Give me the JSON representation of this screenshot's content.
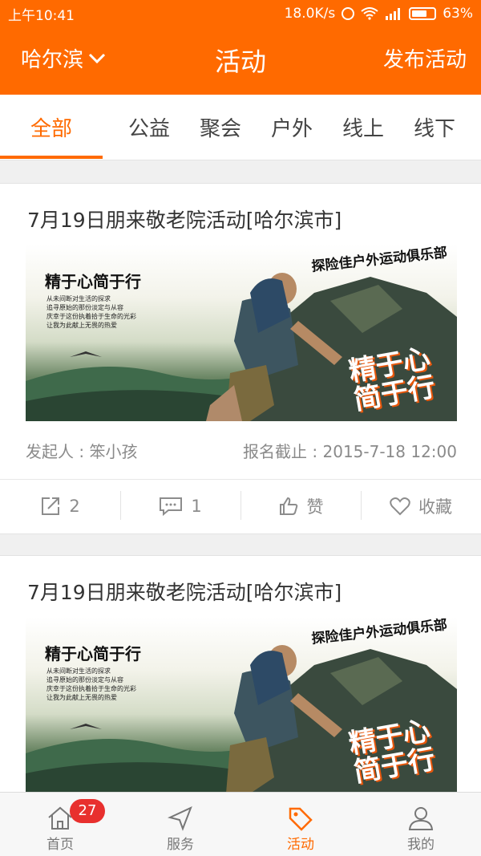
{
  "status_bar": {
    "time": "上午10:41",
    "network_speed": "18.0K/s",
    "battery_percent": "63%"
  },
  "header": {
    "city": "哈尔滨",
    "title": "活动",
    "publish_label": "发布活动",
    "background_color": "#ff6a00"
  },
  "tabs": [
    {
      "label": "全部",
      "active": true
    },
    {
      "label": "公益",
      "active": false
    },
    {
      "label": "聚会",
      "active": false
    },
    {
      "label": "户外",
      "active": false
    },
    {
      "label": "线上",
      "active": false
    },
    {
      "label": "线下",
      "active": false
    }
  ],
  "poster": {
    "headline": "精于心简于行",
    "lines": [
      "从未间断对生活的探求",
      "追寻原始的那份淡定与从容",
      "庆幸于这份执着拾于生命的光彩",
      "让我为此献上无畏的热爱"
    ],
    "club": "探险佳户外运动俱乐部",
    "graffiti_line1": "精于心",
    "graffiti_line2": "简于行"
  },
  "activities": [
    {
      "title": "7月19日朋来敬老院活动[哈尔滨市]",
      "organizer": "发起人 : 笨小孩",
      "deadline": "报名截止 : 2015-7-18 12:00",
      "share_count": "2",
      "comment_count": "1",
      "like_label": "赞",
      "favorite_label": "收藏"
    },
    {
      "title": "7月19日朋来敬老院活动[哈尔滨市]"
    }
  ],
  "bottom_nav": [
    {
      "label": "首页",
      "icon": "home-icon",
      "badge": "27"
    },
    {
      "label": "服务",
      "icon": "navigation-arrow-icon"
    },
    {
      "label": "活动",
      "icon": "tag-icon",
      "active": true
    },
    {
      "label": "我的",
      "icon": "person-icon"
    }
  ]
}
